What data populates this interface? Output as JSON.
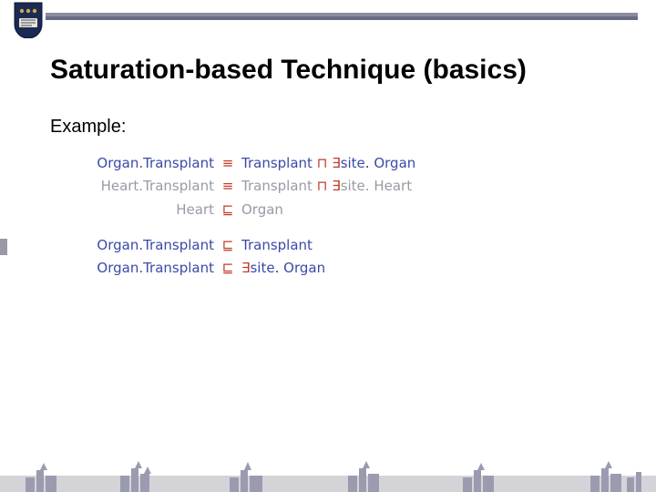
{
  "header": {
    "title": "Saturation-based Technique (basics)"
  },
  "labels": {
    "example": "Example:"
  },
  "symbols": {
    "equiv": "≡",
    "sqsubset": "⊑",
    "sqcap": "⊓",
    "exists": "∃",
    "dot": "."
  },
  "concepts": {
    "organTransplant": "Organ.Transplant",
    "heartTransplant": "Heart.Transplant",
    "transplant": "Transplant",
    "heart": "Heart",
    "organ": "Organ",
    "site": "site"
  }
}
